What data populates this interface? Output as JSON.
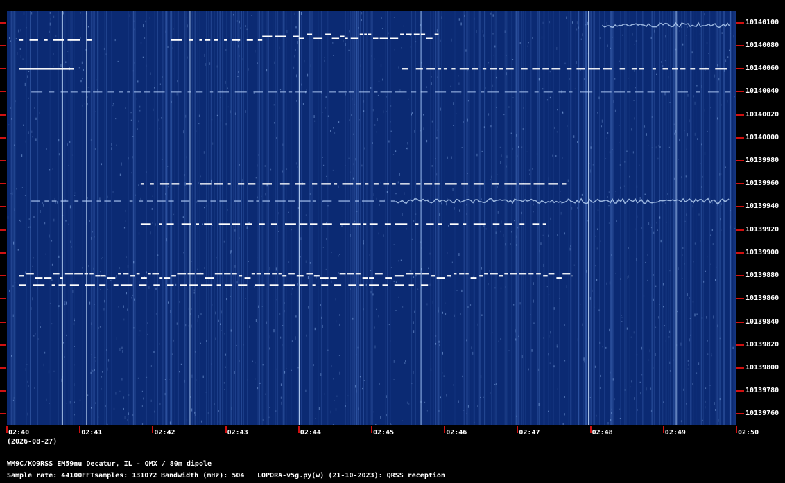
{
  "date_label": "(2026-08-27)",
  "station_label": "WM9C/KQ9RSS EM59nu Decatur, IL - QMX / 80m dipole",
  "info": {
    "sample_rate": "Sample rate: 44100",
    "fft_samples": "FFTsamples: 131072",
    "bandwidth": "Bandwidth (mHz): 504",
    "software": "LOPORA-v5g.py(w) (21-10-2023): QRSS reception"
  },
  "colors": {
    "background": "#000000",
    "spectrogram": "#0b2a73",
    "tick": "#d01010",
    "signal": "#ffffff"
  },
  "x_axis": {
    "labels": [
      "02:40",
      "02:41",
      "02:42",
      "02:43",
      "02:44",
      "02:45",
      "02:46",
      "02:47",
      "02:48",
      "02:49",
      "02:50"
    ]
  },
  "y_axis": {
    "labels": [
      "10140100",
      "10140080",
      "10140060",
      "10140040",
      "10140020",
      "10140000",
      "10139980",
      "10139960",
      "10139940",
      "10139920",
      "10139900",
      "10139880",
      "10139860",
      "10139840",
      "10139820",
      "10139800",
      "10139780",
      "10139760"
    ]
  },
  "chart_data": {
    "type": "heatmap",
    "x_range": [
      "02:40",
      "02:50"
    ],
    "y_range": [
      10139750,
      10140110
    ],
    "traces": [
      {
        "freq": 10140098,
        "start": "02:48:10",
        "end": "02:49:55",
        "style": "wavy"
      },
      {
        "freq": 10140085,
        "start": "02:40:10",
        "end": "02:41:10",
        "style": "dashed"
      },
      {
        "freq": 10140085,
        "start": "02:42:15",
        "end": "02:43:30",
        "style": "dashed"
      },
      {
        "freq": 10140088,
        "start": "02:43:30",
        "end": "02:44:00",
        "style": "dashed"
      },
      {
        "freq": 10140088,
        "start": "02:44:00",
        "end": "02:45:55",
        "style": "dense"
      },
      {
        "freq": 10140060,
        "start": "02:40:10",
        "end": "02:40:55",
        "style": "solid"
      },
      {
        "freq": 10140060,
        "start": "02:45:25",
        "end": "02:49:55",
        "style": "dashed"
      },
      {
        "freq": 10140040,
        "start": "02:40:20",
        "end": "02:49:55",
        "style": "faint"
      },
      {
        "freq": 10139960,
        "start": "02:41:50",
        "end": "02:47:40",
        "style": "dashed"
      },
      {
        "freq": 10139945,
        "start": "02:40:20",
        "end": "02:45:20",
        "style": "faint"
      },
      {
        "freq": 10139945,
        "start": "02:45:20",
        "end": "02:49:55",
        "style": "wavy"
      },
      {
        "freq": 10139925,
        "start": "02:41:50",
        "end": "02:47:25",
        "style": "dashed"
      },
      {
        "freq": 10139880,
        "start": "02:40:10",
        "end": "02:47:45",
        "style": "dense"
      },
      {
        "freq": 10139872,
        "start": "02:40:10",
        "end": "02:45:50",
        "style": "dashed"
      }
    ]
  }
}
